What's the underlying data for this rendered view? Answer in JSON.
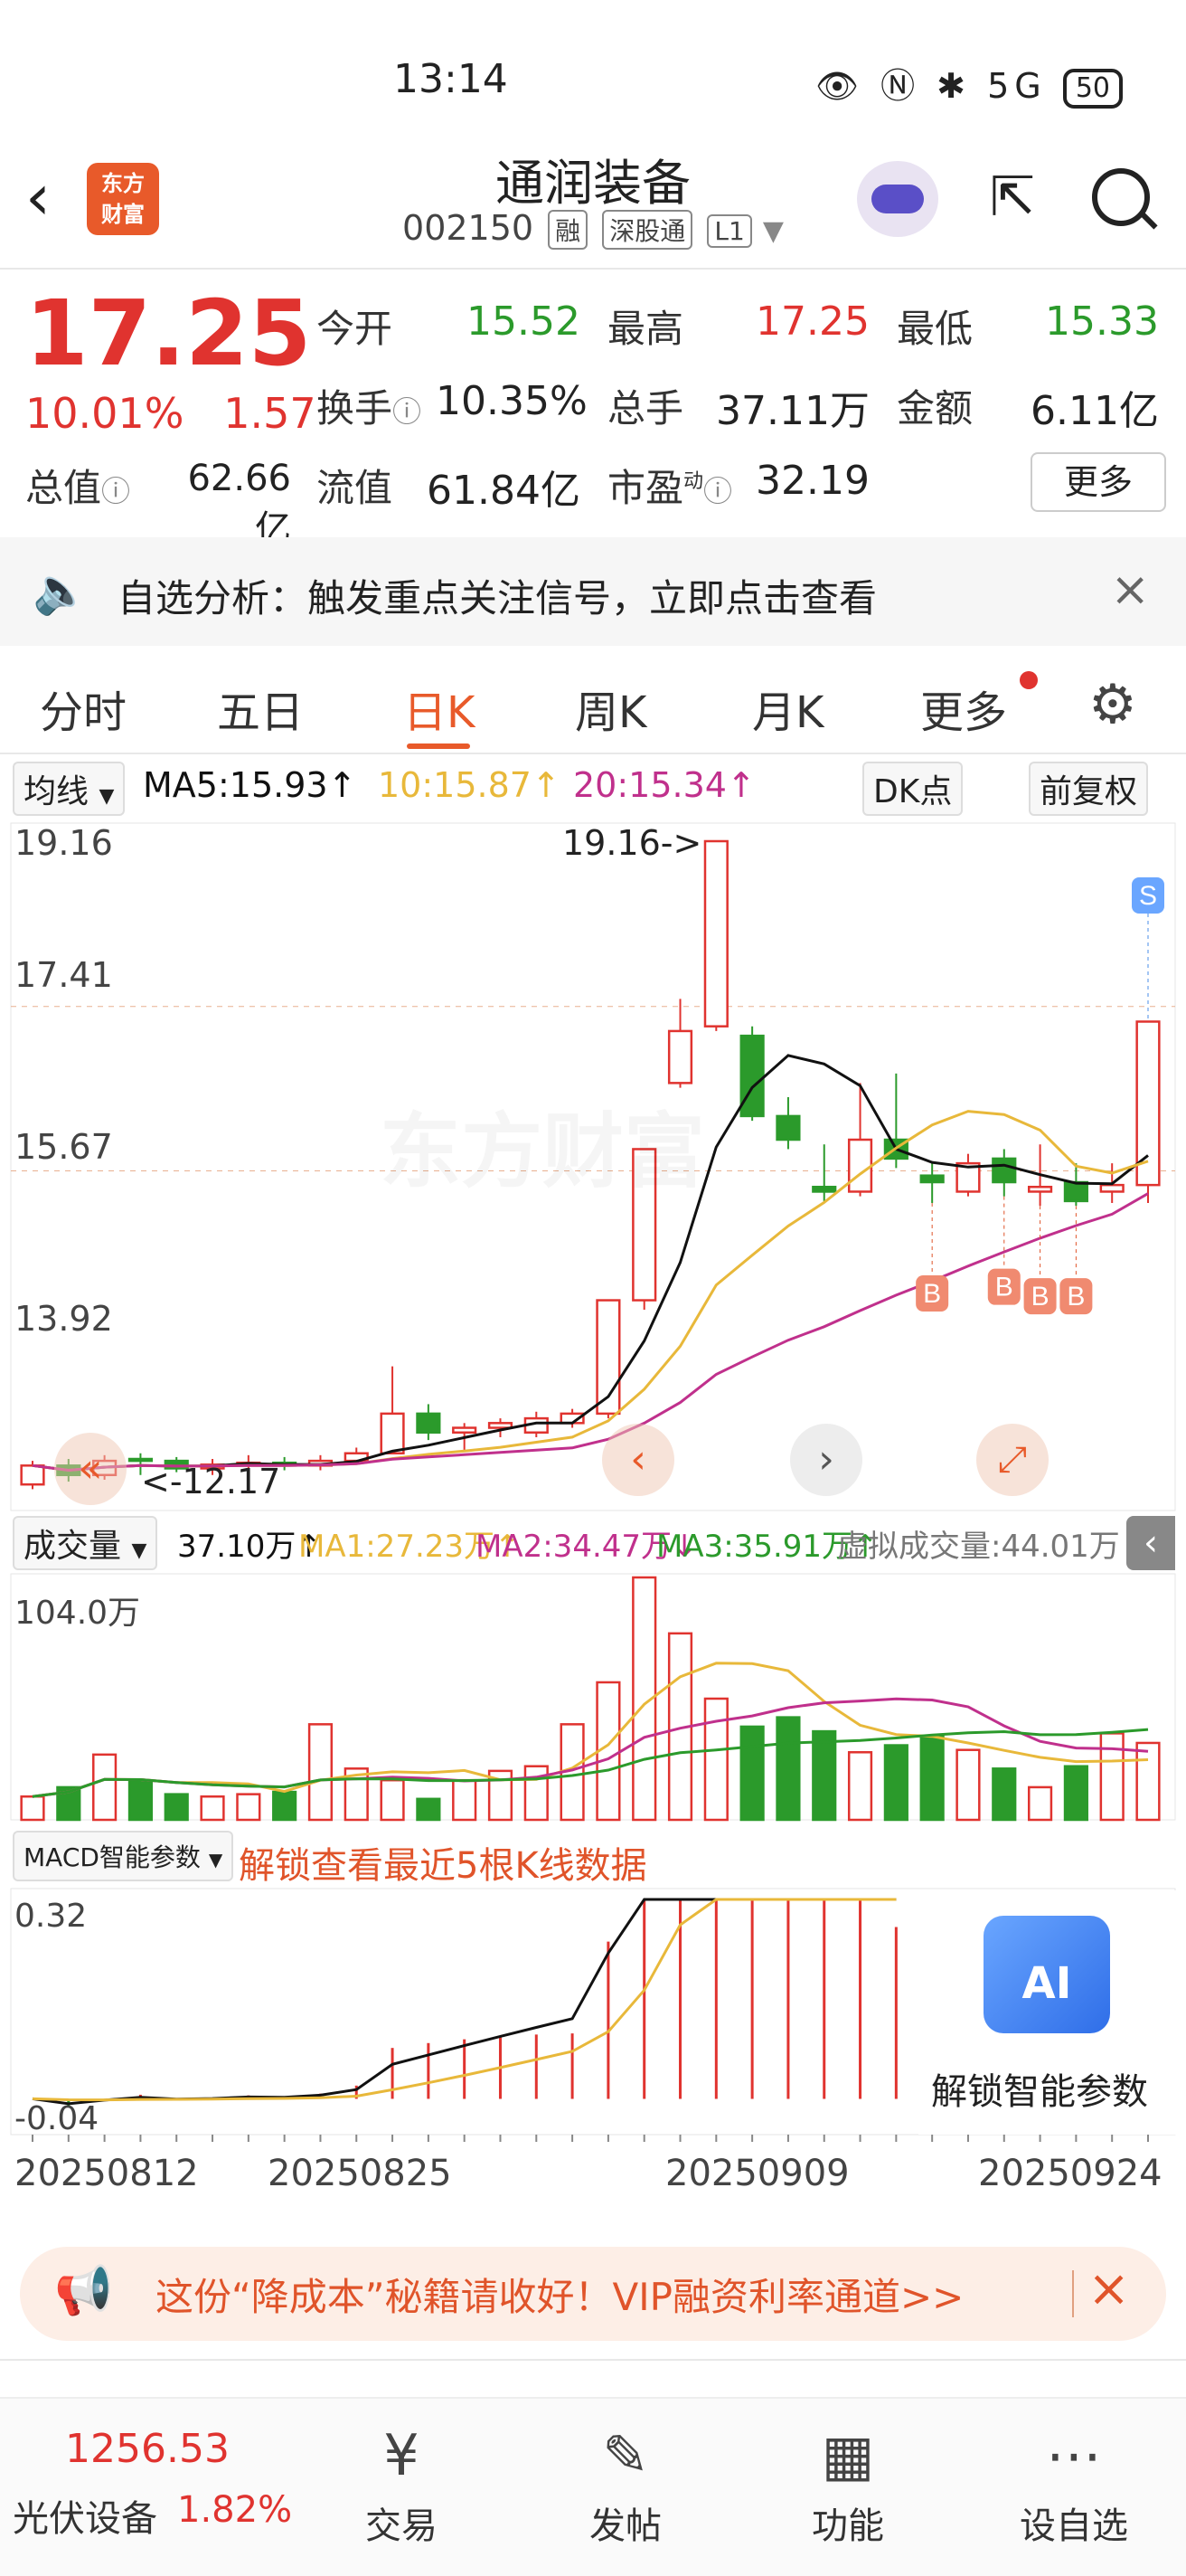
{
  "status_bar": {
    "time": "13:14",
    "icons": "👁 Ⓝ ✱ 5G",
    "battery": "50"
  },
  "header": {
    "logo_line1": "东方",
    "logo_line2": "财富",
    "stock_name": "通润装备",
    "stock_code": "002150",
    "tags": [
      "融",
      "深股通",
      "L1"
    ],
    "back_icon": "chevron-left-icon",
    "share_icon": "share-icon",
    "search_icon": "search-icon"
  },
  "quote": {
    "price": "17.25",
    "change_pct": "10.01%",
    "change_amt": "1.57",
    "open_label": "今开",
    "open": "15.52",
    "high_label": "最高",
    "high": "17.25",
    "low_label": "最低",
    "low": "15.33",
    "turnover_label": "换手",
    "turnover": "10.35%",
    "volume_label": "总手",
    "volume": "37.11万",
    "amount_label": "金额",
    "amount": "6.11亿",
    "mktcap_label": "总值",
    "mktcap": "62.66亿",
    "float_label": "流值",
    "float": "61.84亿",
    "pe_label": "市盈",
    "pe_sup": "动",
    "pe": "32.19",
    "more": "更多"
  },
  "notice": {
    "text": "自选分析：触发重点关注信号，立即点击查看",
    "close": "×"
  },
  "tabs": [
    "分时",
    "五日",
    "日K",
    "周K",
    "月K",
    "更多"
  ],
  "active_tab": "日K",
  "ma_row": {
    "selector": "均线",
    "ma5": "MA5:15.93↑",
    "ma10": "10:15.87↑",
    "ma20": "20:15.34↑",
    "dk": "DK点",
    "adjust": "前复权"
  },
  "kline": {
    "y_labels": [
      "19.16",
      "17.41",
      "15.67",
      "13.92"
    ],
    "max_note": "19.16->",
    "min_note": "<-12.17",
    "sell_marker": "S",
    "buy_marker": "B",
    "watermark": "东方财富"
  },
  "volume_row": {
    "selector": "成交量",
    "vol": "37.10万↑",
    "ma1": "MA1:27.23万↑",
    "ma2": "MA2:34.47万↓",
    "ma3": "MA3:35.91万↑",
    "virtual": "虚拟成交量:44.01万",
    "y_label": "104.0万"
  },
  "macd": {
    "selector": "MACD智能参数",
    "unlock": "解锁查看最近5根K线数据",
    "y_top": "0.32",
    "y_bottom": "-0.04",
    "ai_badge": "AI",
    "ai_text": "解锁智能参数"
  },
  "dates": [
    "20250812",
    "20250825",
    "20250909",
    "20250924"
  ],
  "vip_banner": {
    "text": "这份“降成本”秘籍请收好！VIP融资利率通道>>",
    "close": "×"
  },
  "bottom": {
    "index_value": "1256.53",
    "index_name": "光伏设备",
    "index_change": "1.82%",
    "nav": [
      {
        "label": "交易",
        "icon": "¥"
      },
      {
        "label": "发帖",
        "icon": "✎"
      },
      {
        "label": "功能",
        "icon": "▦"
      },
      {
        "label": "设自选",
        "icon": "⋯"
      }
    ]
  },
  "colors": {
    "up": "#e0332f",
    "down": "#2b9a2b",
    "ma5": "#111111",
    "ma10": "#e8b83a",
    "ma20": "#c0308c",
    "accent": "#e85a2a"
  },
  "chart_data": {
    "type": "candlestick",
    "dates_axis": [
      "20250812",
      "20250825",
      "20250909",
      "20250924"
    ],
    "ylim": [
      12.17,
      19.16
    ],
    "candles": [
      [
        12.35,
        12.55,
        12.3,
        12.6
      ],
      [
        12.55,
        12.45,
        12.38,
        12.62
      ],
      [
        12.45,
        12.6,
        12.4,
        12.66
      ],
      [
        12.62,
        12.6,
        12.45,
        12.68
      ],
      [
        12.6,
        12.52,
        12.48,
        12.64
      ],
      [
        12.52,
        12.56,
        12.45,
        12.62
      ],
      [
        12.56,
        12.58,
        12.5,
        12.66
      ],
      [
        12.58,
        12.55,
        12.5,
        12.64
      ],
      [
        12.55,
        12.6,
        12.5,
        12.66
      ],
      [
        12.6,
        12.68,
        12.58,
        12.74
      ],
      [
        12.68,
        13.1,
        12.7,
        13.6
      ],
      [
        13.1,
        12.9,
        12.82,
        13.2
      ],
      [
        12.9,
        12.95,
        12.7,
        13.0
      ],
      [
        12.95,
        13.0,
        12.85,
        13.05
      ],
      [
        12.9,
        13.05,
        12.85,
        13.12
      ],
      [
        13.0,
        13.1,
        12.95,
        13.15
      ],
      [
        13.1,
        14.3,
        13.05,
        14.3
      ],
      [
        14.3,
        15.9,
        14.2,
        15.9
      ],
      [
        16.6,
        17.15,
        16.55,
        17.49
      ],
      [
        17.2,
        19.16,
        17.15,
        19.16
      ],
      [
        17.1,
        16.25,
        16.2,
        17.2
      ],
      [
        16.25,
        16.0,
        15.9,
        16.45
      ],
      [
        15.5,
        15.45,
        15.35,
        15.95
      ],
      [
        15.45,
        16.0,
        15.4,
        16.6
      ],
      [
        16.0,
        15.8,
        15.7,
        16.7
      ],
      [
        15.62,
        15.55,
        15.33,
        15.75
      ],
      [
        15.45,
        15.75,
        15.4,
        15.85
      ],
      [
        15.8,
        15.55,
        15.4,
        15.9
      ],
      [
        15.45,
        15.5,
        15.3,
        15.95
      ],
      [
        15.55,
        15.35,
        15.3,
        15.75
      ],
      [
        15.45,
        15.52,
        15.33,
        15.75
      ],
      [
        15.52,
        17.25,
        15.33,
        17.25
      ]
    ],
    "volume_wan": [
      10,
      14,
      28,
      17,
      11,
      10,
      11,
      12,
      41,
      22,
      17,
      9,
      17,
      21,
      23,
      41,
      59,
      104,
      80,
      52,
      40,
      44,
      38,
      29,
      32,
      36,
      30,
      22,
      14,
      23,
      37.1,
      33
    ]
  }
}
